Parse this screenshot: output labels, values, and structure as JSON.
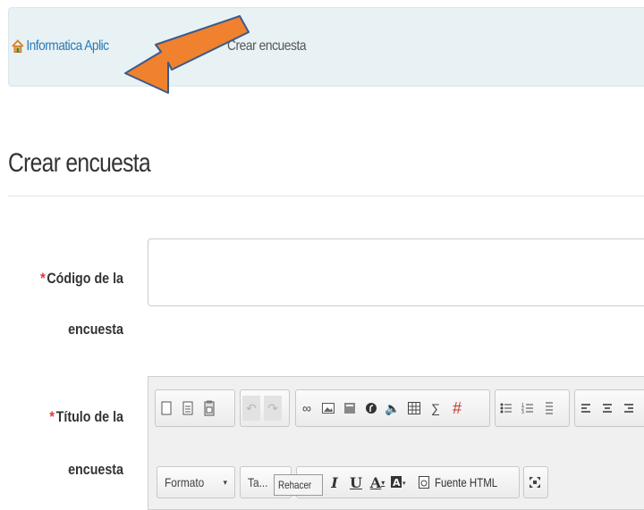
{
  "breadcrumb": {
    "home_label": "Informatica Aplic",
    "current_label": "Crear encuesta",
    "home_icon": "home-icon"
  },
  "annotation": {
    "arrow_color": "#f0812e",
    "arrow_outline": "#3b5a8a"
  },
  "page": {
    "title": "Crear encuesta"
  },
  "form": {
    "code_field": {
      "required_mark": "*",
      "label_line1": "Código de la",
      "label_line2": "encuesta",
      "value": ""
    },
    "title_field": {
      "required_mark": "*",
      "label_line1": "Título de la",
      "label_line2": "encuesta"
    }
  },
  "editor": {
    "format_combo": "Formato",
    "size_combo": "Ta...",
    "tooltip": "Rehacer",
    "source_button": "Fuente HTML",
    "icons": [
      "new-page-icon",
      "preview-icon",
      "paste-word-icon",
      "undo-icon",
      "redo-icon",
      "link-icon",
      "image-icon",
      "flash-icon",
      "special-char-icon",
      "audio-icon",
      "table-icon",
      "formula-icon",
      "strike-formula-icon",
      "bulleted-list-icon",
      "numbered-list-icon",
      "line-list-icon",
      "align-left-icon",
      "align-center-icon",
      "align-right-icon",
      "bold-icon",
      "italic-icon",
      "underline-icon",
      "text-color-icon",
      "bg-color-icon",
      "source-icon",
      "maximize-icon"
    ]
  }
}
